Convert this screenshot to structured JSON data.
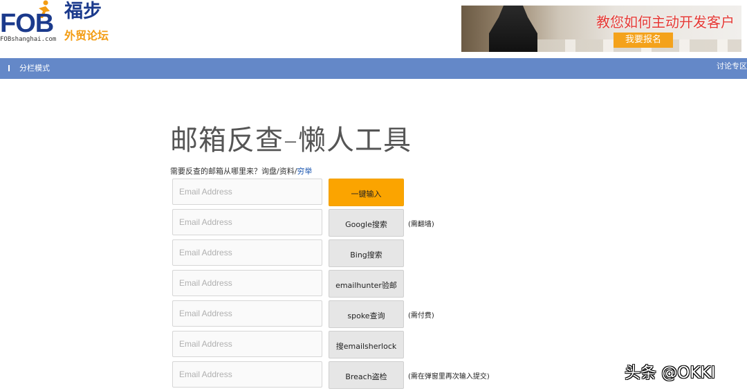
{
  "header": {
    "logo": {
      "brand": "FOB",
      "domain": "FOBshanghai.com",
      "name_line1": "福步",
      "name_line2": "外贸论坛"
    },
    "ad": {
      "title": "教您如何主动开发客户",
      "button": "我要报名"
    }
  },
  "nav": {
    "left_label": "分栏模式",
    "right_label": "讨论专区"
  },
  "main": {
    "title": "邮箱反查–懒人工具",
    "question_prefix": "需要反查的邮箱从哪里来？询盘/资料/",
    "question_link": "穷举",
    "rows": [
      {
        "placeholder": "Email Address",
        "button": "一键输入",
        "note": "",
        "primary": true
      },
      {
        "placeholder": "Email Address",
        "button": "Google搜索",
        "note": "(需翻墙)"
      },
      {
        "placeholder": "Email Address",
        "button": "Bing搜索",
        "note": ""
      },
      {
        "placeholder": "Email Address",
        "button": "emailhunter验邮",
        "note": ""
      },
      {
        "placeholder": "Email Address",
        "button": "spoke查询",
        "note": "(需付费)"
      },
      {
        "placeholder": "Email Address",
        "button": "搜emailsherlock",
        "note": ""
      },
      {
        "placeholder": "Email Address",
        "button": "Breach盗检",
        "note": "(需在弹窗里再次输入提交)"
      }
    ]
  },
  "watermark": "头条 @OKKI",
  "colors": {
    "navbar": "#6488c8",
    "primary_button": "#fba400",
    "ad_title": "#e53935",
    "link": "#1a56b0"
  }
}
